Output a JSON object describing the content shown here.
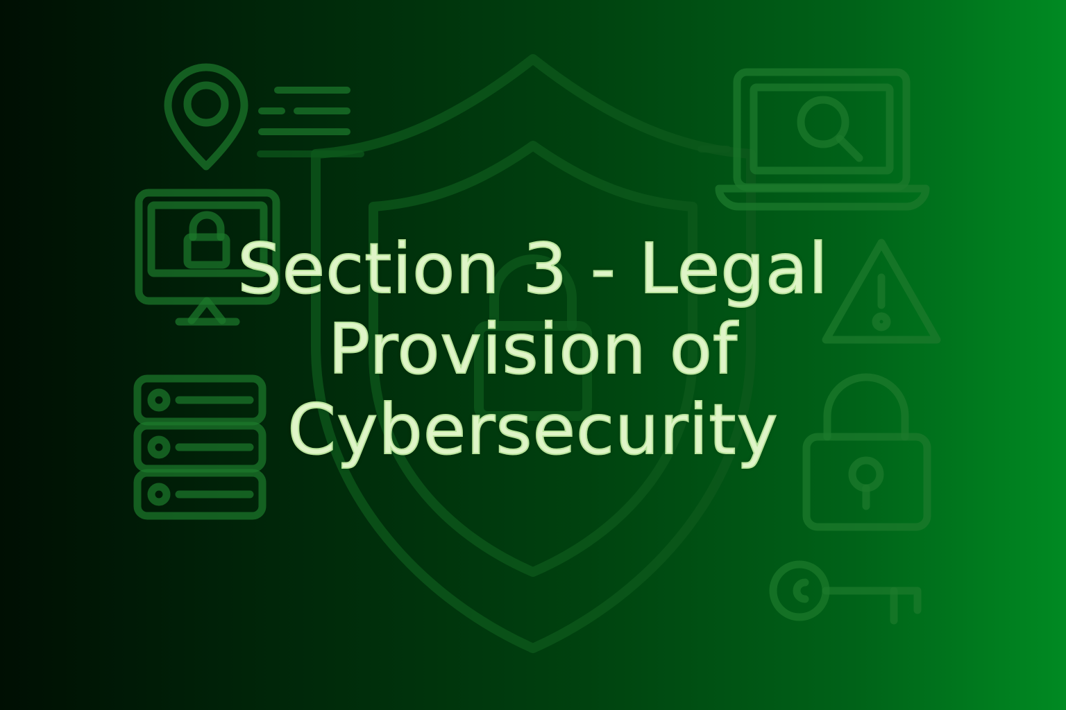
{
  "colors": {
    "background_dark": "#000f03",
    "background_light": "#008a22",
    "icon_stroke": "#1c7a2c",
    "title_fill": "#dff5c8",
    "title_outline": "#b9e39b"
  },
  "title": {
    "line1": "Section 3 - Legal",
    "line2": "Provision of",
    "line3": "Cybersecurity"
  },
  "icons": [
    "shield-icon",
    "location-pin-icon",
    "text-lines-icon",
    "monitor-lock-icon",
    "server-stack-icon",
    "laptop-search-icon",
    "warning-triangle-icon",
    "padlock-icon",
    "key-icon"
  ]
}
